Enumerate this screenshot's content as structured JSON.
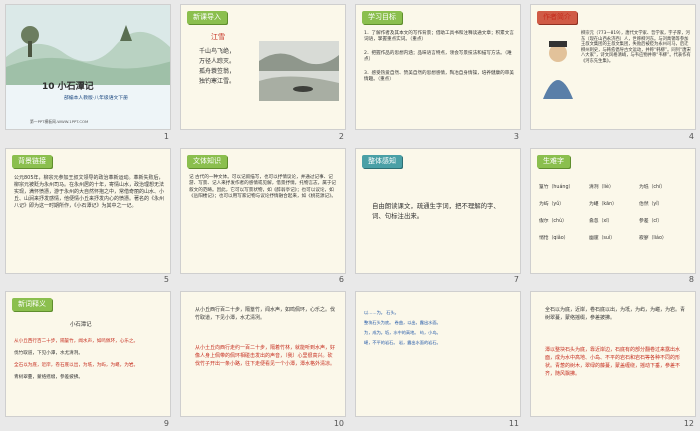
{
  "slides": [
    {
      "num": "1",
      "title": "10 小石潭记",
      "subtitle": "部编本人教版·八年级语文下册",
      "footer": "第一PPT模板网-WWW.1PPT.COM"
    },
    {
      "num": "2",
      "tab": "新课导入",
      "poem_title": "江雪",
      "poem_lines": [
        "千山鸟飞绝，",
        "万径人踪灭。",
        "孤舟蓑笠翁，",
        "独钓寒江雪。"
      ]
    },
    {
      "num": "3",
      "tab": "学习目标",
      "goals": [
        "1．了解作者及其本文的写作背景；借助工具书和注释读通文章；积累文言词语，掌握重点实词。（重点）",
        "2．把握作品的思想内涵；品味语言特点，领会写景技法和描写方法。（难点）",
        "3．感受热爱自然、赞美自然的思想感情，陶冶自身情操，培养健康的审美情趣。（重点）"
      ]
    },
    {
      "num": "4",
      "tab": "作者简介",
      "author_text": "柳宗元（773—819），唐代文学家、哲学家，字子厚，河东（现在山西永济西）人，世称柳河东。与刘禹锡等参加王叔文集团的王叔文集团，失败后被贬为永州司马，后迁柳州刺史，与韩愈倡导古文运动，并称“韩柳”。同列“唐宋八大家”，诗文风格清峭，与韦应物并称“韦柳”。代表作有《河东先生集》。"
    },
    {
      "num": "5",
      "tab": "背景链接",
      "bg_text": "公元805年，柳宗元参加王叔文领导的政治革新运动。革新失败后，柳宗元被贬为永州司马。在永州居的十年，寄情山水，政治理想无法实现，满怀愤懑，游于永州的大自然怀抱之中，常借奇丽的山水、小丘、山涧来抒发感情，他便情小丘来抒发内心的愤懑。著名的《永州八记》即为这一时期所作，《小石潭记》为其中之一记。"
    },
    {
      "num": "6",
      "tab": "文体知识",
      "genre_text": "记 古代的一种文体。可以记叙描写，也可以抒情议论，并通过记事、记游、写景、记人来抒发作者的感情或见解，借景抒情，托物言志，属于记叙文的范畴。因此，它可以写景状物，如《醉翁亭记》；也可以议论，如《岳阳楼记》；也可以用写家记物与议论抒情融合起来，如《桃花源记》。"
    },
    {
      "num": "7",
      "tab": "整体感知",
      "task": "自由朗读课文，疏通生字词，把不理解的字、词、句标注出来。"
    },
    {
      "num": "8",
      "tab": "生难字",
      "words": [
        [
          "篁竹（huáng）",
          "清冽（liè）",
          "为坻（chí）"
        ],
        [
          "为屿（yǔ）",
          "为嵁（kān）",
          "佁然（yǐ）"
        ],
        [
          "俶尔（chù）",
          "翕忽（xī）",
          "参差（cī）"
        ],
        [
          "悄怆（qiǎo）",
          "幽邃（suì）",
          "寂寥（liáo）"
        ]
      ]
    },
    {
      "num": "9",
      "tab": "新词释义",
      "heading": "小石潭记",
      "lines": [
        "从小丘西行百二十步，隔篁竹，闻水声，如鸣佩环，心乐之。",
        "伐竹取道，下见小潭，水尤清冽。",
        "全石以为底，近岸，卷石底以出，为坻，为屿，为嵁，为岩。",
        "青树翠蔓，蒙络摇缀，参差披拂。"
      ]
    },
    {
      "num": "10",
      "para1": "从小丘西行百二十步，隔篁竹，闻水声，如鸣佩环，心乐之。伐竹取道，下见小潭，水尤清冽。",
      "para2": "从小土丘向西行走约一百二十步，隔着竹林，就能听到水声，好像人身上佩带的佩环相碰击发出的声音，（我）心里很高兴。砍伐竹子开出一条小路，往下走便看见一个小潭，潭水格外清凉。"
    },
    {
      "num": "11",
      "notes": [
        "以……为。",
        "石头。",
        "整块石头为底。",
        "卷曲，以出，露出水面。",
        "为，成为。坻，水中的高地。",
        "屿，小岛。",
        "嵁，不平的岩石。",
        "岩，露出水面的岩石。"
      ]
    },
    {
      "num": "12",
      "para1": "全石以为底，近岸，卷石底以出，为坻，为屿，为嵁，为岩。青树翠蔓，蒙络摇缀，参差披拂。",
      "para2": "潭以整块石头为底，靠近岸边，石底有的部分翻卷过来露出水面，成为水中高地、小岛、不平的岩石和岩石等各种不同的形状。青葱的树木，翠绿的藤蔓，蒙盖缠绕，摇动下垂，参差不齐，随风飘拂。"
    }
  ]
}
